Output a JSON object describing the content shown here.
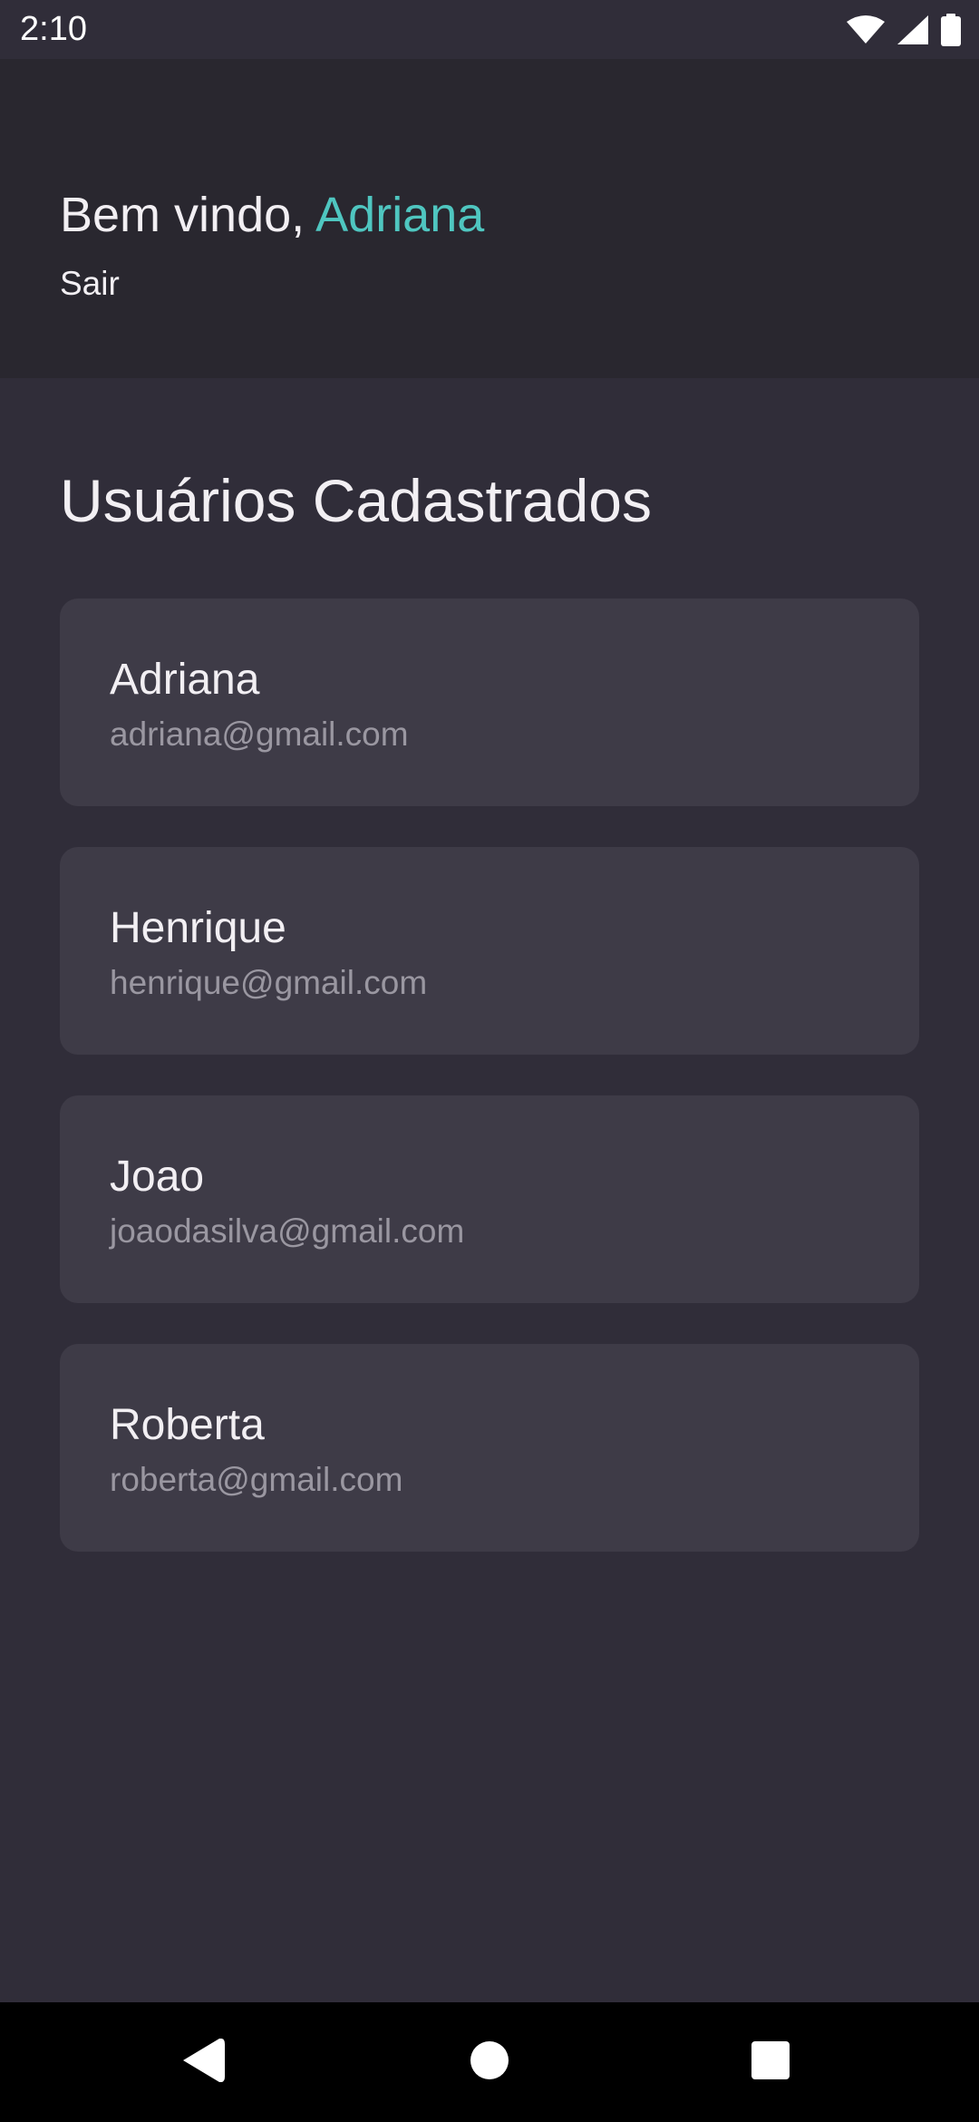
{
  "status_bar": {
    "time": "2:10",
    "icons": [
      "wifi-icon",
      "signal-icon",
      "battery-icon"
    ]
  },
  "header": {
    "greeting_prefix": "Bem vindo, ",
    "user_name": "Adriana",
    "logout_label": "Sair",
    "accent_color": "#4fc6c0"
  },
  "main": {
    "title": "Usuários Cadastrados",
    "users": [
      {
        "name": "Adriana",
        "email": "adriana@gmail.com"
      },
      {
        "name": "Henrique",
        "email": "henrique@gmail.com"
      },
      {
        "name": "Joao",
        "email": "joaodasilva@gmail.com"
      },
      {
        "name": "Roberta",
        "email": "roberta@gmail.com"
      }
    ]
  },
  "nav_bar": {
    "icons": [
      "back-icon",
      "home-icon",
      "recents-icon"
    ]
  },
  "colors": {
    "background": "#302d39",
    "header_background": "#29272f",
    "card_background": "#3e3b47",
    "text_primary": "#f2eff3",
    "text_secondary": "#9a97a1",
    "accent": "#4fc6c0"
  }
}
